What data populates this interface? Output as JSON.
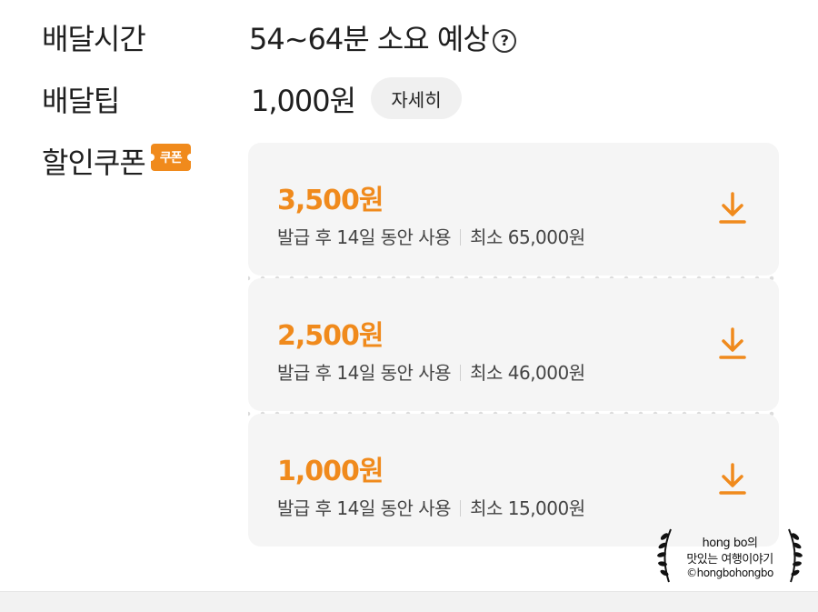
{
  "delivery_time": {
    "label": "배달시간",
    "value": "54~64분 소요 예상",
    "help_icon": "?"
  },
  "delivery_tip": {
    "label": "배달팁",
    "value": "1,000원",
    "detail_button": "자세히"
  },
  "discount_coupon": {
    "label": "할인쿠폰",
    "badge": "쿠폰",
    "accent_color": "#f08a1c",
    "coupons": [
      {
        "amount": "3,500원",
        "validity": "발급 후 14일 동안 사용",
        "minimum": "최소 65,000원",
        "icon": "download-icon"
      },
      {
        "amount": "2,500원",
        "validity": "발급 후 14일 동안 사용",
        "minimum": "최소 46,000원",
        "icon": "download-icon"
      },
      {
        "amount": "1,000원",
        "validity": "발급 후 14일 동안 사용",
        "minimum": "최소 15,000원",
        "icon": "download-icon"
      }
    ]
  },
  "watermark": {
    "line1": "hong bo의",
    "line2": "맛있는 여행이야기",
    "line3": "©hongbohongbo"
  }
}
